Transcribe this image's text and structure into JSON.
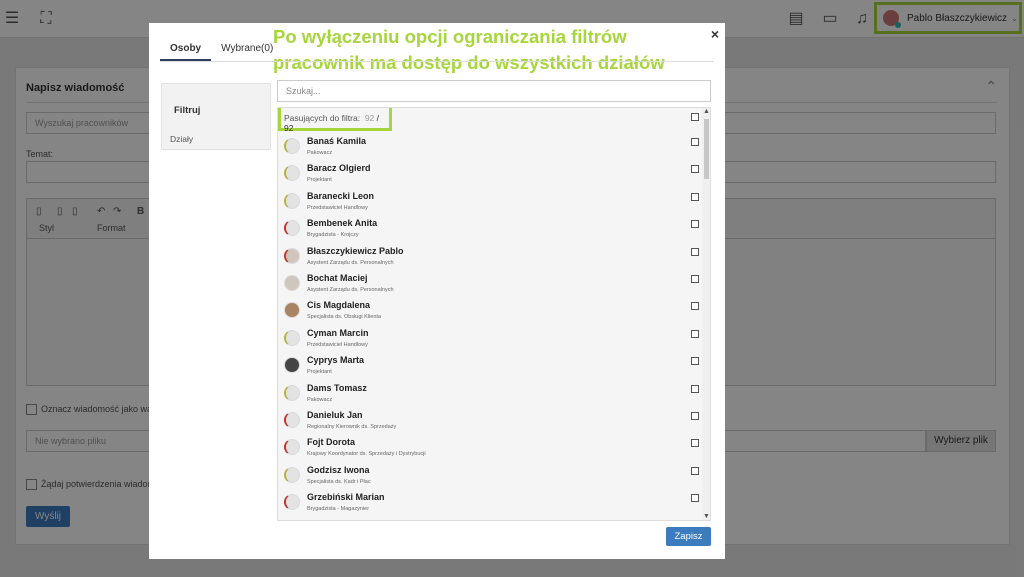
{
  "background": {
    "user_name": "Pablo Błaszczykiewicz",
    "panel_title": "Napisz wiadomość",
    "search_placeholder": "Wyszukaj pracowników",
    "subject_label": "Temat:",
    "editor_font_select": "Styl",
    "editor_format_select": "Format",
    "important_label": "Oznacz wiadomość jako wa",
    "no_file_text": "Nie wybrano pliku",
    "choose_file_label": "Wybierz plik",
    "confirm_label": "Żądaj potwierdzenia wiadom",
    "send_label": "Wyślij"
  },
  "modal": {
    "annotation": "Po wyłączeniu opcji ograniczania filtrów pracownik ma dostęp do wszystkich działów",
    "tabs": [
      {
        "label": "Osoby",
        "active": true
      },
      {
        "label": "Wybrane(0)",
        "active": false
      }
    ],
    "filter": {
      "title": "Filtruj",
      "item": "Działy"
    },
    "search_placeholder": "Szukaj...",
    "count": {
      "label": "Pasujących do filtra:",
      "matched": "92",
      "separator": "/",
      "total": "92"
    },
    "people": [
      {
        "name": "Banaś Kamila",
        "role": "Pakowacz",
        "avatar": "default"
      },
      {
        "name": "Baracz Olgierd",
        "role": "Projektant",
        "avatar": "default"
      },
      {
        "name": "Baranecki Leon",
        "role": "Przedstawiciel Handlowy",
        "avatar": "default"
      },
      {
        "name": "Bembenek Anita",
        "role": "Brygadzista - Krojczy",
        "avatar": "red"
      },
      {
        "name": "Błaszczykiewicz Pablo",
        "role": "Asystent Zarządu ds. Personalnych",
        "avatar": "person-red"
      },
      {
        "name": "Bochat Maciej",
        "role": "Asystent Zarządu ds. Personalnych",
        "avatar": "person"
      },
      {
        "name": "Cis Magdalena",
        "role": "Specjalista ds. Obsługi Klienta",
        "avatar": "brown"
      },
      {
        "name": "Cyman Marcin",
        "role": "Przedstawiciel Handlowy",
        "avatar": "default"
      },
      {
        "name": "Cyprys Marta",
        "role": "Projektant",
        "avatar": "dark"
      },
      {
        "name": "Dams Tomasz",
        "role": "Pakowacz",
        "avatar": "default"
      },
      {
        "name": "Danieluk Jan",
        "role": "Regionalny Kierownik ds. Sprzedaży",
        "avatar": "red"
      },
      {
        "name": "Fojt Dorota",
        "role": "Krajowy Koordynator ds. Sprzedaży i Dystrybucji",
        "avatar": "red"
      },
      {
        "name": "Godzisz Iwona",
        "role": "Specjalista ds. Kadr i Płac",
        "avatar": "default"
      },
      {
        "name": "Grzebiński Marian",
        "role": "Brygadzista - Magazynier",
        "avatar": "red"
      }
    ],
    "save_label": "Zapisz",
    "close_icon": "×"
  },
  "colors": {
    "highlight": "#a6d63c",
    "primary": "#3d7bbf",
    "tab_underline": "#2b3e63"
  }
}
